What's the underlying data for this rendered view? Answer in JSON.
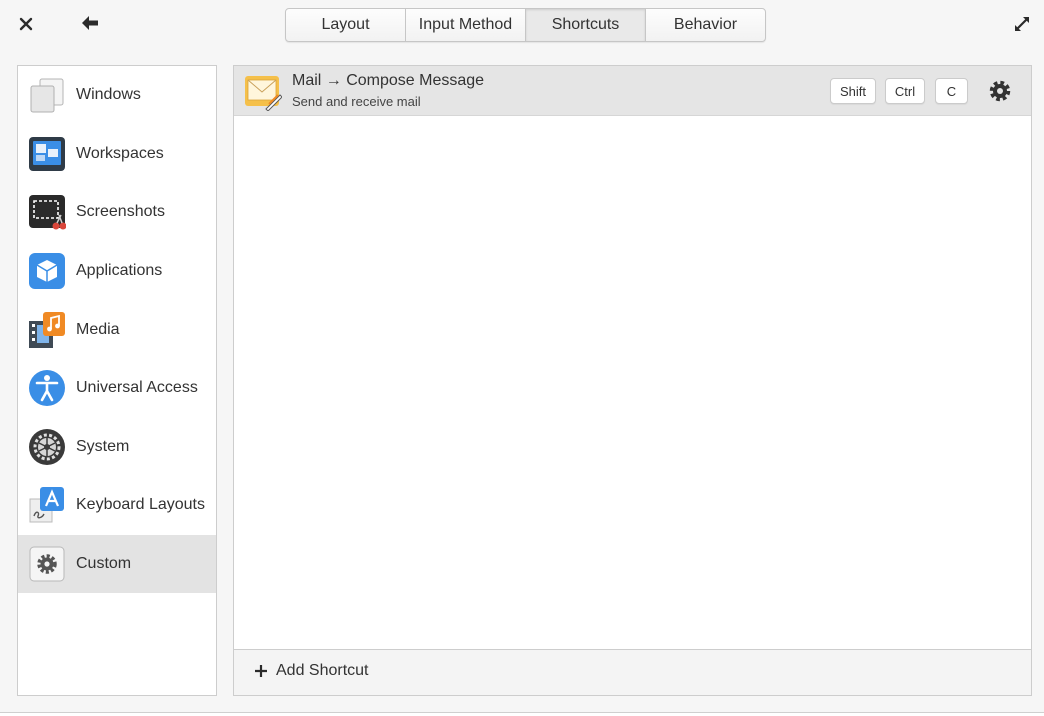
{
  "header": {
    "tabs": [
      {
        "label": "Layout",
        "active": false
      },
      {
        "label": "Input Method",
        "active": false
      },
      {
        "label": "Shortcuts",
        "active": true
      },
      {
        "label": "Behavior",
        "active": false
      }
    ]
  },
  "sidebar": {
    "items": [
      {
        "label": "Windows",
        "icon": "windows-icon"
      },
      {
        "label": "Workspaces",
        "icon": "workspaces-icon"
      },
      {
        "label": "Screenshots",
        "icon": "screenshots-icon"
      },
      {
        "label": "Applications",
        "icon": "applications-icon"
      },
      {
        "label": "Media",
        "icon": "media-icon"
      },
      {
        "label": "Universal Access",
        "icon": "universal-access-icon"
      },
      {
        "label": "System",
        "icon": "system-icon"
      },
      {
        "label": "Keyboard Layouts",
        "icon": "keyboard-layouts-icon"
      },
      {
        "label": "Custom",
        "icon": "custom-icon",
        "selected": true
      }
    ]
  },
  "shortcuts": [
    {
      "title": "Mail → Compose Message",
      "subtitle": "Send and receive mail",
      "keys": [
        "Shift",
        "Ctrl",
        "C"
      ]
    }
  ],
  "footer": {
    "add_label": "Add Shortcut"
  },
  "colors": {
    "selected_row": "#e3e3e3",
    "accent_blue": "#3a8ee6",
    "media_orange": "#f08a24",
    "mail_yellow": "#f5c04a"
  }
}
